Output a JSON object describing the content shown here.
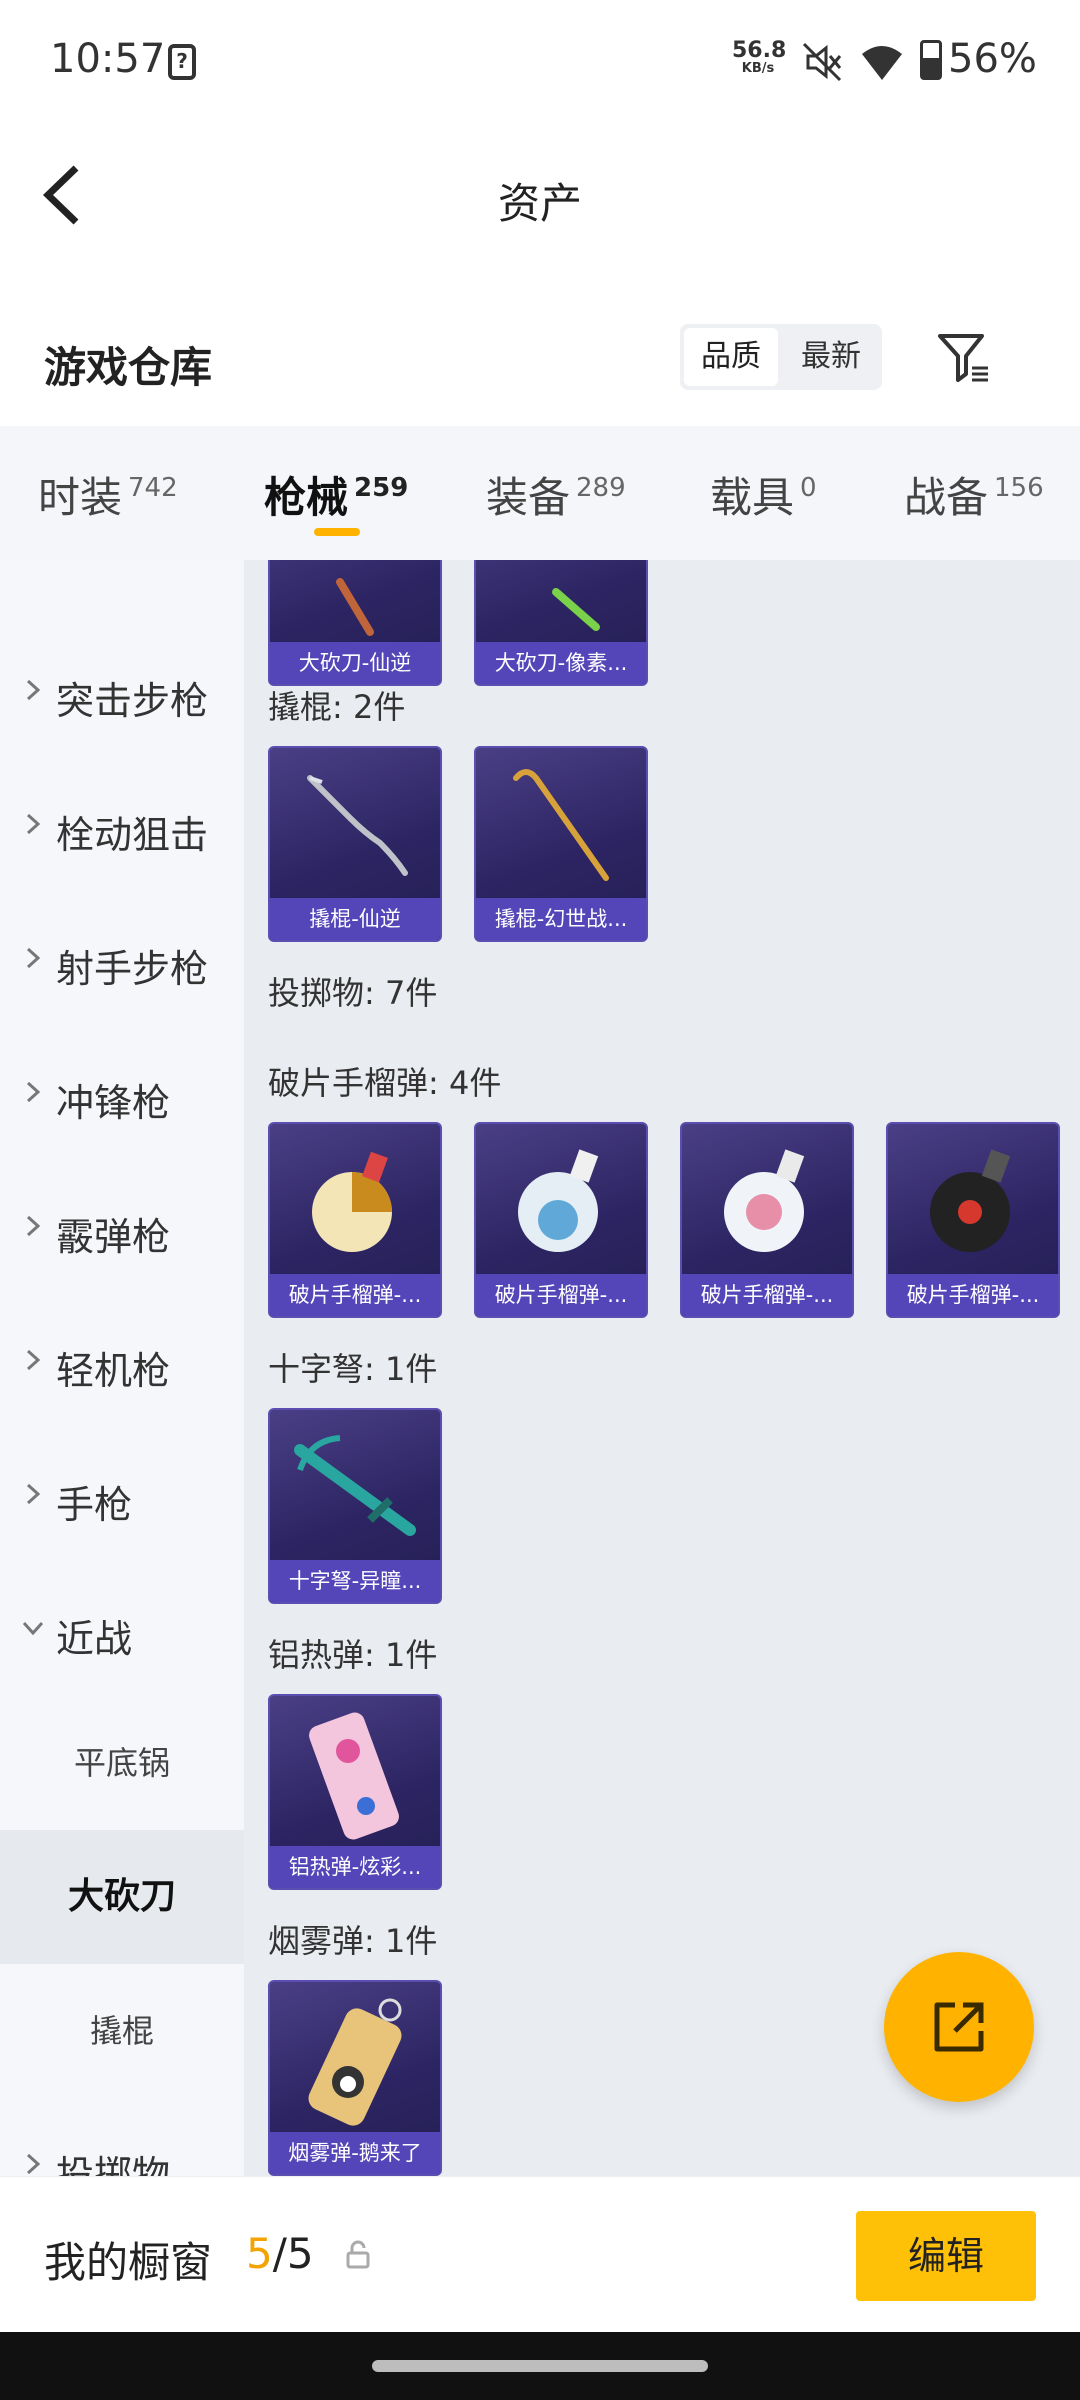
{
  "status_bar": {
    "time": "10:57",
    "sim_icon": "sim-card-question-icon",
    "speed_value": "56.8",
    "speed_unit": "KB/s",
    "battery": "56%"
  },
  "header": {
    "title": "资产"
  },
  "warehouse": {
    "title": "游戏仓库",
    "sort_options": [
      "品质",
      "最新"
    ],
    "selected_sort": "品质"
  },
  "tabs": [
    {
      "label": "时装",
      "count": "742"
    },
    {
      "label": "枪械",
      "count": "259",
      "active": true
    },
    {
      "label": "装备",
      "count": "289"
    },
    {
      "label": "载具",
      "count": "0"
    },
    {
      "label": "战备",
      "count": "156"
    }
  ],
  "sidebar": {
    "categories": [
      "突击步枪",
      "栓动狙击",
      "射手步枪",
      "冲锋枪",
      "霰弹枪",
      "轻机枪",
      "手枪",
      "近战",
      "投掷物"
    ],
    "subitems": [
      "平底锅",
      "大砍刀",
      "撬棍"
    ],
    "active_sub": "大砍刀"
  },
  "content": {
    "top_cards": [
      "大砍刀-仙逆",
      "大砍刀-像素..."
    ],
    "sections": [
      {
        "title": "撬棍: 2件",
        "cards": [
          "撬棍-仙逆",
          "撬棍-幻世战..."
        ]
      },
      {
        "title": "投掷物: 7件"
      },
      {
        "title": "破片手榴弹: 4件",
        "cards": [
          "破片手榴弹-...",
          "破片手榴弹-...",
          "破片手榴弹-...",
          "破片手榴弹-..."
        ]
      },
      {
        "title": "十字弩: 1件",
        "cards": [
          "十字弩-异瞳..."
        ]
      },
      {
        "title": "铝热弹: 1件",
        "cards": [
          "铝热弹-炫彩..."
        ]
      },
      {
        "title": "烟雾弹: 1件",
        "cards": [
          "烟雾弹-鹅来了"
        ]
      }
    ]
  },
  "bottom_bar": {
    "label": "我的橱窗",
    "current": "5",
    "separator": "/",
    "total": "5",
    "edit_label": "编辑"
  },
  "colors": {
    "accent": "#ffb300",
    "card_bg": "#2d2563",
    "card_caption": "#5445b8"
  }
}
